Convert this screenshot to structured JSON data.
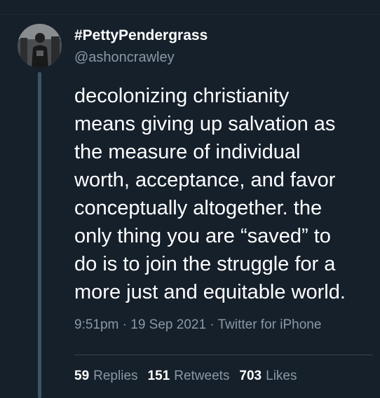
{
  "tweet": {
    "display_name": "#PettyPendergrass",
    "handle": "@ashoncrawley",
    "text_lines": [
      "decolonizing christianity",
      "means giving up salvation as",
      "the measure of individual",
      "worth, acceptance, and favor",
      "conceptually altogether. the",
      "only thing you are “saved” to",
      "do is to join the struggle for a",
      "more just and equitable world."
    ],
    "time": "9:51pm",
    "date": "19 Sep 2021",
    "source": "Twitter for iPhone",
    "separator": "·"
  },
  "stats": {
    "replies_count": "59",
    "replies_label": "Replies",
    "retweets_count": "151",
    "retweets_label": "Retweets",
    "likes_count": "703",
    "likes_label": "Likes"
  },
  "colors": {
    "background": "#15202b",
    "primary_text": "#ffffff",
    "secondary_text": "#8b98a5",
    "thread_line": "#3d5466",
    "divider": "#38444d"
  },
  "icons": {
    "avatar": "profile-photo"
  }
}
